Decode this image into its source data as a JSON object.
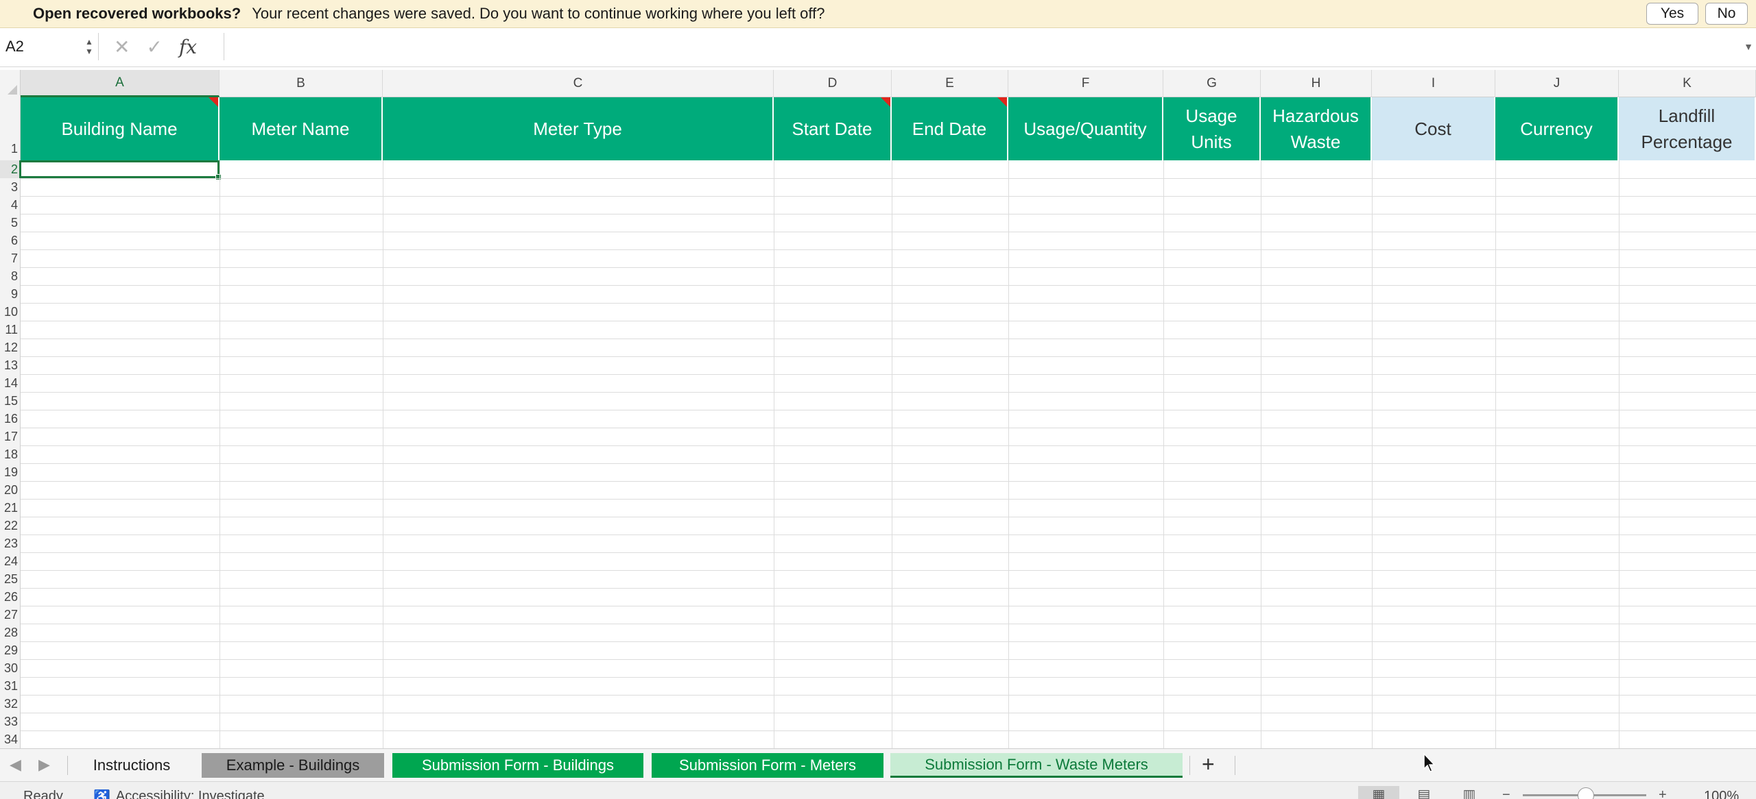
{
  "recovery_bar": {
    "title": "Open recovered workbooks?",
    "message": "Your recent changes were saved. Do you want to continue working where you left off?",
    "yes_label": "Yes",
    "no_label": "No"
  },
  "formula_bar": {
    "name_box": "A2",
    "fx_label": "fx",
    "formula": ""
  },
  "columns": [
    "A",
    "B",
    "C",
    "D",
    "E",
    "F",
    "G",
    "H",
    "I",
    "J",
    "K"
  ],
  "header_cells": [
    {
      "text": "Building Name",
      "style": "green",
      "comment": true
    },
    {
      "text": "Meter Name",
      "style": "green",
      "comment": false
    },
    {
      "text": "Meter Type",
      "style": "green",
      "comment": false
    },
    {
      "text": "Start Date",
      "style": "green",
      "comment": true
    },
    {
      "text": "End Date",
      "style": "green",
      "comment": true
    },
    {
      "text": "Usage/Quantity",
      "style": "green",
      "comment": false
    },
    {
      "text": "Usage\nUnits",
      "style": "green",
      "comment": false
    },
    {
      "text": "Hazardous\nWaste",
      "style": "green",
      "comment": false
    },
    {
      "text": "Cost",
      "style": "light",
      "comment": false
    },
    {
      "text": "Currency",
      "style": "green",
      "comment": false
    },
    {
      "text": "Landfill\nPercentage",
      "style": "light",
      "comment": false
    }
  ],
  "row_numbers": [
    "1",
    "2",
    "3",
    "4",
    "5",
    "6",
    "7",
    "8",
    "9",
    "10",
    "11",
    "12",
    "13",
    "14",
    "15",
    "16",
    "17",
    "18",
    "19",
    "20",
    "21",
    "22",
    "23",
    "24",
    "25",
    "26",
    "27",
    "28",
    "29",
    "30",
    "31",
    "32",
    "33",
    "34"
  ],
  "active_cell": "A2",
  "sheet_tabs": [
    {
      "label": "Instructions",
      "style": "plain"
    },
    {
      "label": "Example - Buildings",
      "style": "gray"
    },
    {
      "label": "Submission Form - Buildings",
      "style": "green"
    },
    {
      "label": "Submission Form - Meters",
      "style": "green"
    },
    {
      "label": "Submission Form - Waste Meters",
      "style": "active"
    }
  ],
  "tab_add_label": "+",
  "status_bar": {
    "ready": "Ready",
    "accessibility": "Accessibility: Investigate",
    "zoom": "100%"
  },
  "colors": {
    "header_green": "#00ab7b",
    "header_light_blue": "#d1e7f3",
    "tab_green": "#00a650",
    "selection_green": "#1c7a3f",
    "recovery_bar_bg": "#fbf2d6"
  }
}
